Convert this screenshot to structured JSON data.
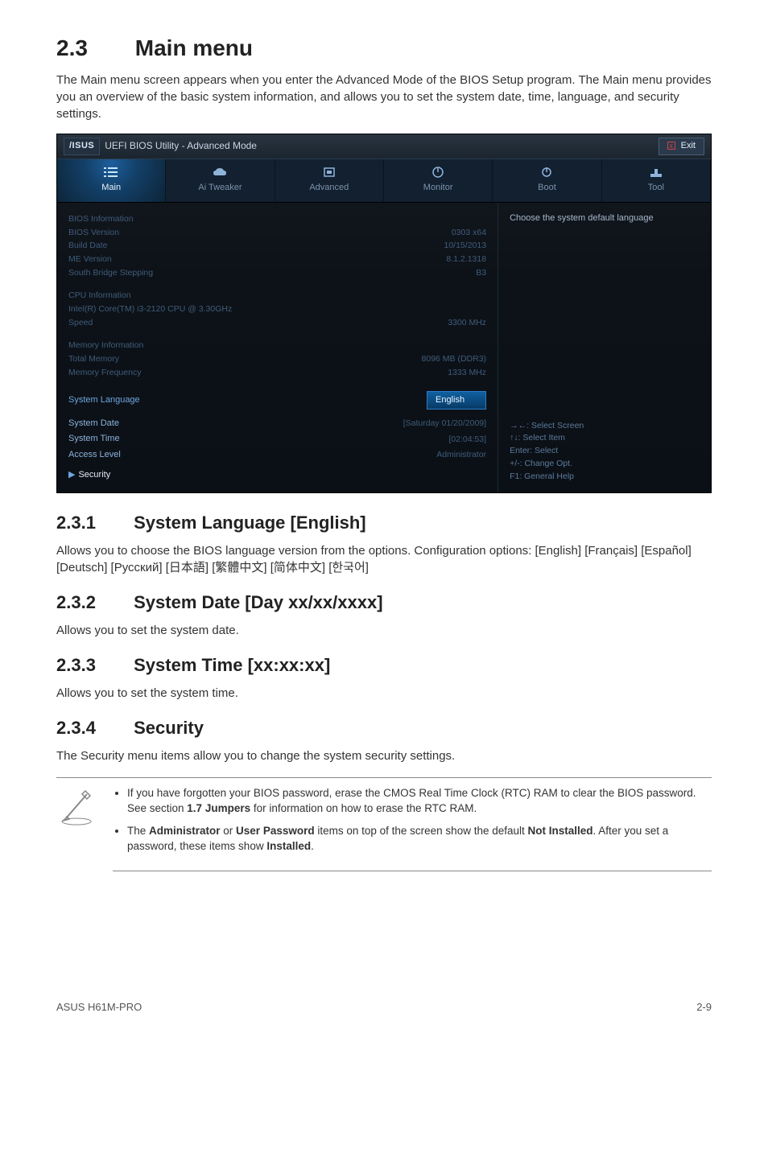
{
  "section": {
    "number": "2.3",
    "title": "Main menu",
    "intro": "The Main menu screen appears when you enter the Advanced Mode of the BIOS Setup program. The Main menu provides you an overview of the basic system information, and allows you to set the system date, time, language, and security settings."
  },
  "bios": {
    "brand": "/ISUS",
    "titlebar": "UEFI BIOS Utility - Advanced Mode",
    "exit_label": "Exit",
    "tabs": {
      "main": "Main",
      "ai_tweaker": "Ai Tweaker",
      "advanced": "Advanced",
      "monitor": "Monitor",
      "boot": "Boot",
      "tool": "Tool"
    },
    "bios_info_header": "BIOS Information",
    "bios_info": {
      "version_label": "BIOS Version",
      "version_value": "0303 x64",
      "build_date_label": "Build Date",
      "build_date_value": "10/15/2013",
      "me_version_label": "ME Version",
      "me_version_value": "8.1.2.1318",
      "south_bridge_label": "South Bridge Stepping",
      "south_bridge_value": "B3"
    },
    "cpu_info_header": "CPU Information",
    "cpu_info": {
      "model_label": "Intel(R) Core(TM) i3-2120 CPU @ 3.30GHz",
      "speed_label": "Speed",
      "speed_value": "3300 MHz"
    },
    "memory_info_header": "Memory Information",
    "memory_info": {
      "total_label": "Total Memory",
      "total_value": "8096 MB (DDR3)",
      "freq_label": "Memory Frequency",
      "freq_value": "1333 MHz"
    },
    "system_language_label": "System Language",
    "system_language_value": "English",
    "system_date_label": "System Date",
    "system_date_value": "[Saturday 01/20/2009]",
    "system_time_label": "System Time",
    "system_time_value": "[02:04:53]",
    "access_level_label": "Access Level",
    "access_level_value": "Administrator",
    "security_label": "Security",
    "help_panel": "Choose the system default language",
    "key_help": {
      "select_screen": "→←: Select Screen",
      "select_item": "↑↓: Select Item",
      "enter": "Enter: Select",
      "change": "+/-: Change Opt.",
      "general_help": "F1: General Help"
    }
  },
  "subsections": {
    "s231_num": "2.3.1",
    "s231_title": "System Language [English]",
    "s231_body": "Allows you to choose the BIOS language version from the options. Configuration options: [English] [Français] [Español] [Deutsch] [Русский] [日本語] [繁體中文] [简体中文] [한국어]",
    "s232_num": "2.3.2",
    "s232_title": "System Date [Day xx/xx/xxxx]",
    "s232_body": "Allows you to set the system date.",
    "s233_num": "2.3.3",
    "s233_title": "System Time [xx:xx:xx]",
    "s233_body": "Allows you to set the system time.",
    "s234_num": "2.3.4",
    "s234_title": "Security",
    "s234_body": "The Security menu items allow you to change the system security settings."
  },
  "notes": {
    "item1_a": "If you have forgotten your BIOS password, erase the CMOS Real Time Clock (RTC) RAM to clear the BIOS password. See section ",
    "item1_b": "1.7 Jumpers",
    "item1_c": " for information on how to erase the RTC RAM.",
    "item2_a": "The ",
    "item2_b": "Administrator",
    "item2_c": " or ",
    "item2_d": "User Password",
    "item2_e": " items on top of the screen show the default ",
    "item2_f": "Not Installed",
    "item2_g": ". After you set a password, these items show ",
    "item2_h": "Installed",
    "item2_i": "."
  },
  "footer": {
    "left": "ASUS H61M-PRO",
    "right": "2-9"
  }
}
